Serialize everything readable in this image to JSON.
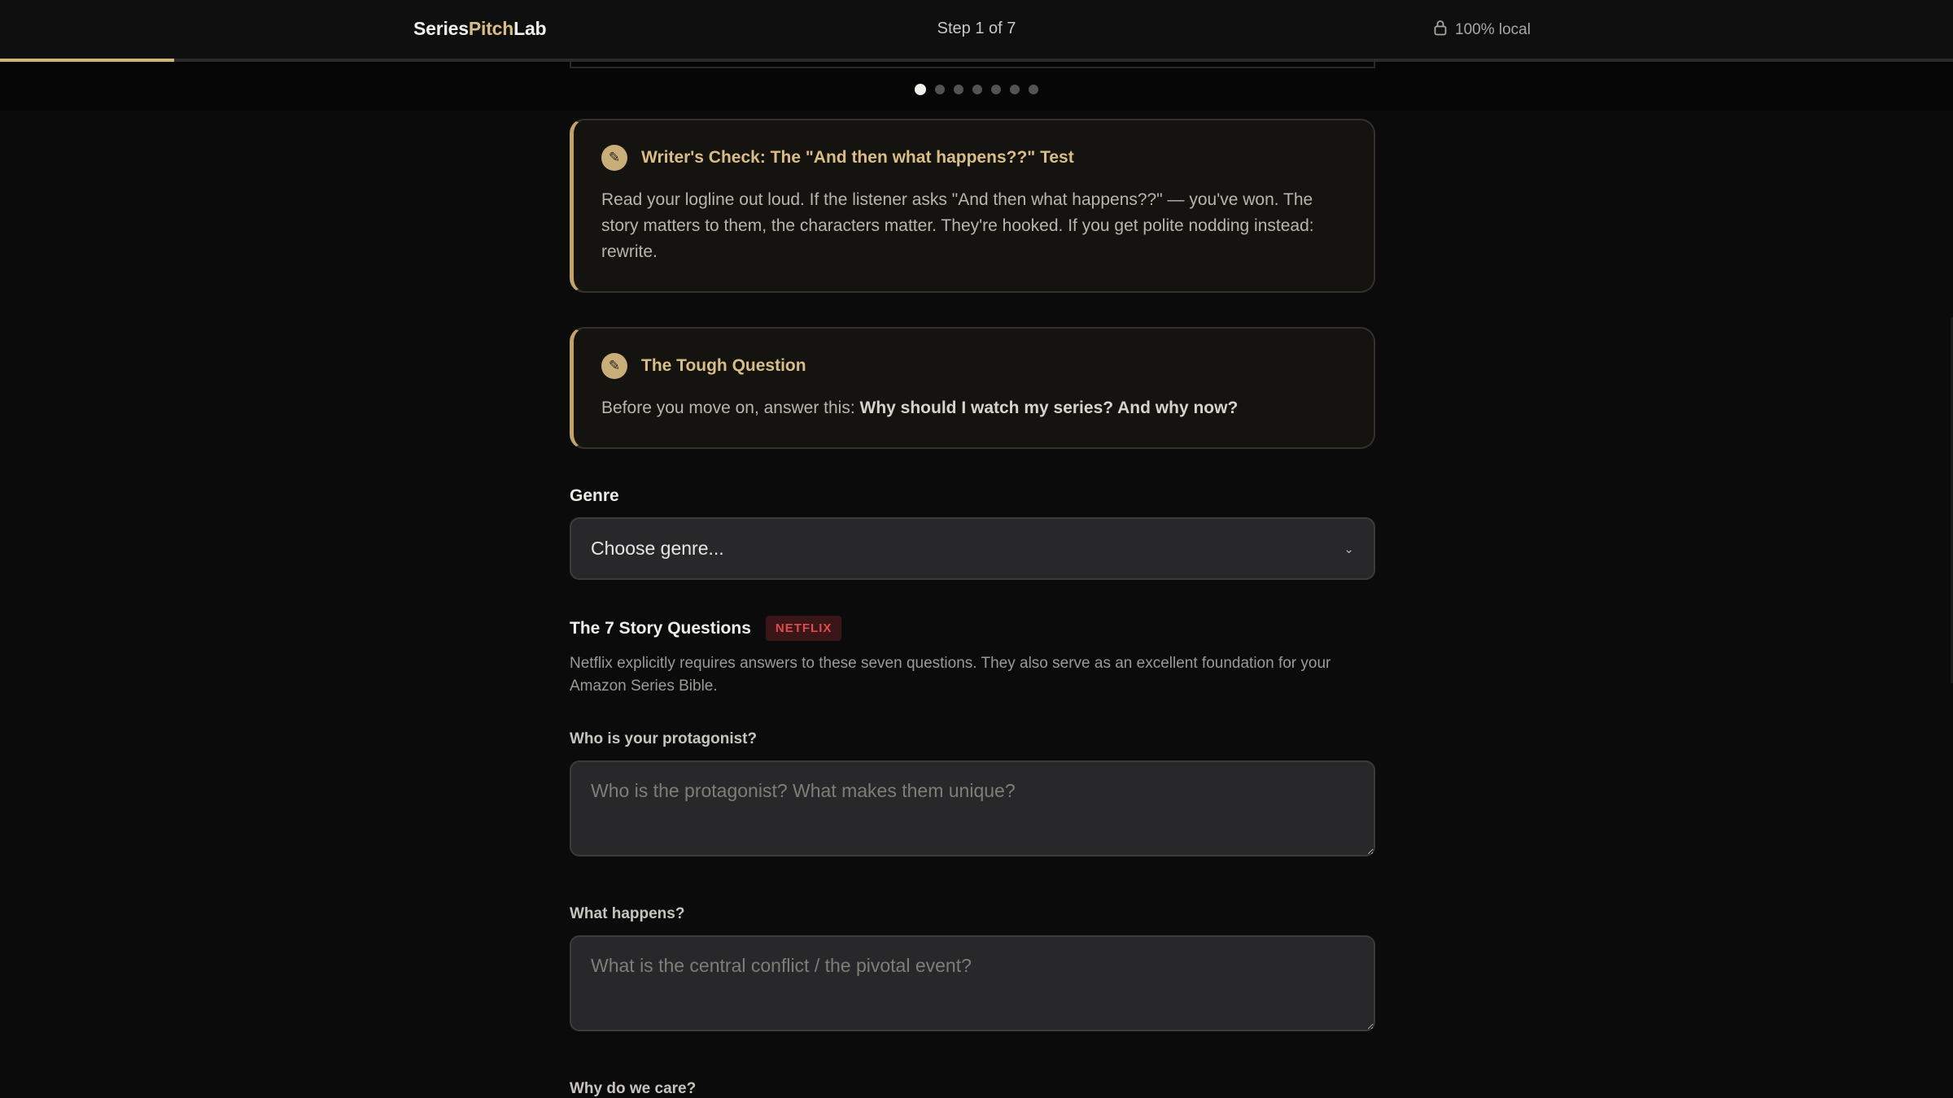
{
  "header": {
    "brand_part1": "Series",
    "brand_part2": "Pitch",
    "brand_part3": "Lab",
    "step_label": "Step 1 of 7",
    "local_label": "100% local",
    "progress": 0.089,
    "accent_color": "#cfb37a"
  },
  "steps": {
    "total": 7,
    "current": 1
  },
  "callouts": [
    {
      "title": "Writer's Check: The \"And then what happens??\" Test",
      "body": "Read your logline out loud. If the listener asks \"And then what happens??\" — you've won. The story matters to them, the characters matter. They're hooked. If you get polite nodding instead: rewrite."
    },
    {
      "title": "The Tough Question",
      "body_prefix": "Before you move on, answer this: ",
      "body_bold": "Why should I watch my series? And why now?"
    }
  ],
  "genre": {
    "label": "Genre",
    "placeholder": "Choose genre..."
  },
  "story_questions": {
    "title": "The 7 Story Questions",
    "badge": "NETFLIX",
    "badge_color": "#e04c4c",
    "description": "Netflix explicitly requires answers to these seven questions. They also serve as an excellent foundation for your Amazon Series Bible.",
    "questions": [
      {
        "label": "Who is your protagonist?",
        "placeholder": "Who is the protagonist? What makes them unique?",
        "value": ""
      },
      {
        "label": "What happens?",
        "placeholder": "What is the central conflict / the pivotal event?",
        "value": ""
      },
      {
        "label": "Why do we care?"
      }
    ]
  }
}
